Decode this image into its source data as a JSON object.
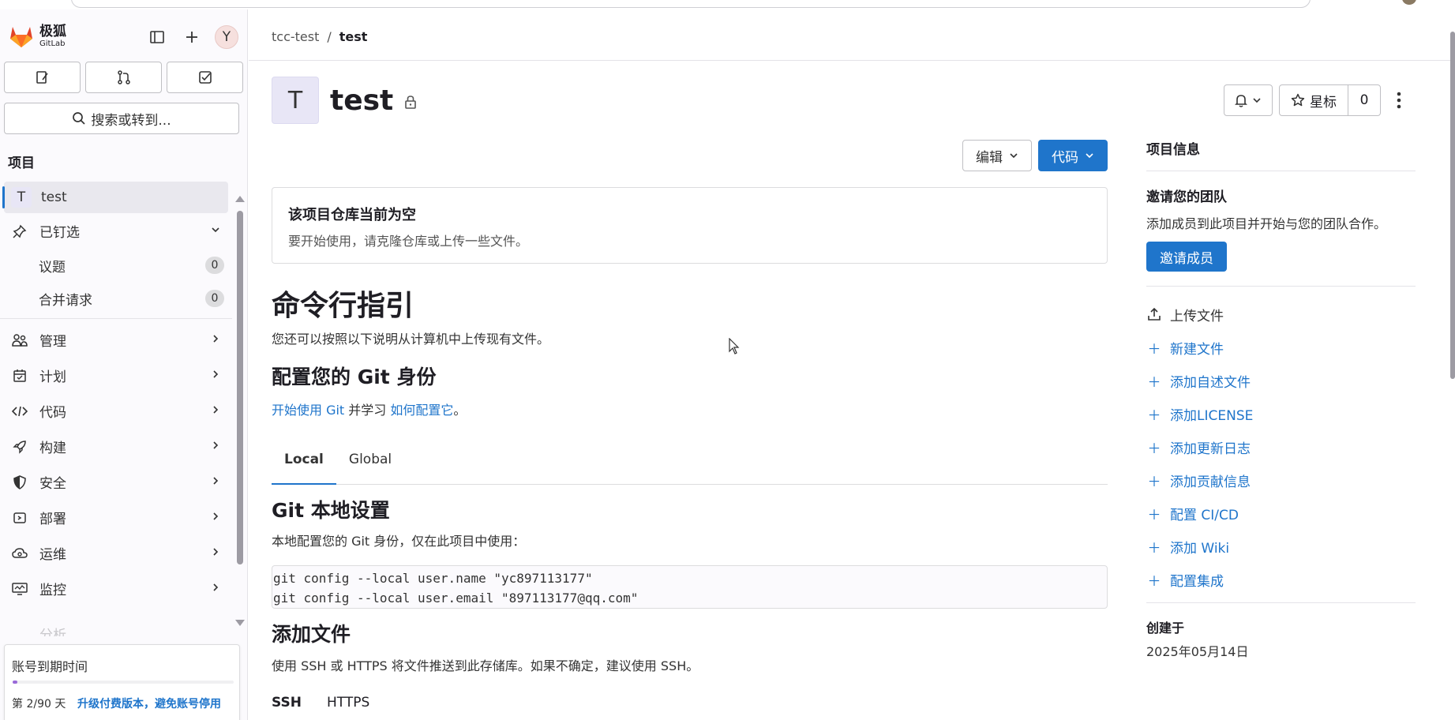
{
  "sidebar": {
    "brand_cn": "极狐",
    "brand_en": "GitLab",
    "avatar_letter": "Y",
    "search_label": "搜索或转到...",
    "section_title": "项目",
    "project": {
      "initial": "T",
      "name": "test"
    },
    "pinned_label": "已钉选",
    "pinned_items": [
      {
        "label": "议题",
        "count": "0"
      },
      {
        "label": "合并请求",
        "count": "0"
      }
    ],
    "menu": [
      {
        "label": "管理",
        "icon": "users-icon"
      },
      {
        "label": "计划",
        "icon": "calendar-icon"
      },
      {
        "label": "代码",
        "icon": "code-icon"
      },
      {
        "label": "构建",
        "icon": "rocket-icon"
      },
      {
        "label": "安全",
        "icon": "shield-icon"
      },
      {
        "label": "部署",
        "icon": "deploy-icon"
      },
      {
        "label": "运维",
        "icon": "cloud-icon"
      },
      {
        "label": "监控",
        "icon": "monitor-icon"
      }
    ],
    "ghost_item": "分析",
    "trial": {
      "title": "账号到期时间",
      "progress": 0.022,
      "day_text": "第 2/90 天",
      "upgrade_link": "升级付费版本，避免账号停用"
    }
  },
  "breadcrumb": {
    "parent": "tcc-test",
    "sep": "/",
    "current": "test"
  },
  "project": {
    "avatar_letter": "T",
    "title": "test",
    "star_label": "星标",
    "star_count": "0",
    "edit_label": "编辑",
    "code_label": "代码"
  },
  "empty_notice": {
    "title": "该项目仓库当前为空",
    "desc": "要开始使用，请克隆仓库或上传一些文件。"
  },
  "guide": {
    "title": "命令行指引",
    "desc": "您还可以按照以下说明从计算机中上传现有文件。",
    "identity_title": "配置您的 Git 身份",
    "identity_link1": "开始使用 Git",
    "identity_mid": " 并学习 ",
    "identity_link2": "如何配置它",
    "identity_end": "。",
    "tabs": [
      "Local",
      "Global"
    ],
    "local_title": "Git 本地设置",
    "local_desc": "本地配置您的 Git 身份，仅在此项目中使用：",
    "code_lines": [
      "git config --local user.name \"yc897113177\"",
      "git config --local user.email \"897113177@qq.com\""
    ],
    "add_title": "添加文件",
    "add_desc": "使用 SSH 或 HTTPS 将文件推送到此存储库。如果不确定，建议使用 SSH。",
    "proto_tabs": [
      "SSH",
      "HTTPS"
    ]
  },
  "right_panel": {
    "title": "项目信息",
    "invite_title": "邀请您的团队",
    "invite_desc": "添加成员到此项目并开始与您的团队合作。",
    "invite_button": "邀请成员",
    "upload": "上传文件",
    "links": [
      "新建文件",
      "添加自述文件",
      "添加LICENSE",
      "添加更新日志",
      "添加贡献信息",
      "配置 CI/CD",
      "添加 Wiki",
      "配置集成"
    ],
    "created_label": "创建于",
    "created_date": "2025年05月14日"
  },
  "colors": {
    "accent": "#1f75cb",
    "sidebar_bg": "#fbfafd"
  }
}
